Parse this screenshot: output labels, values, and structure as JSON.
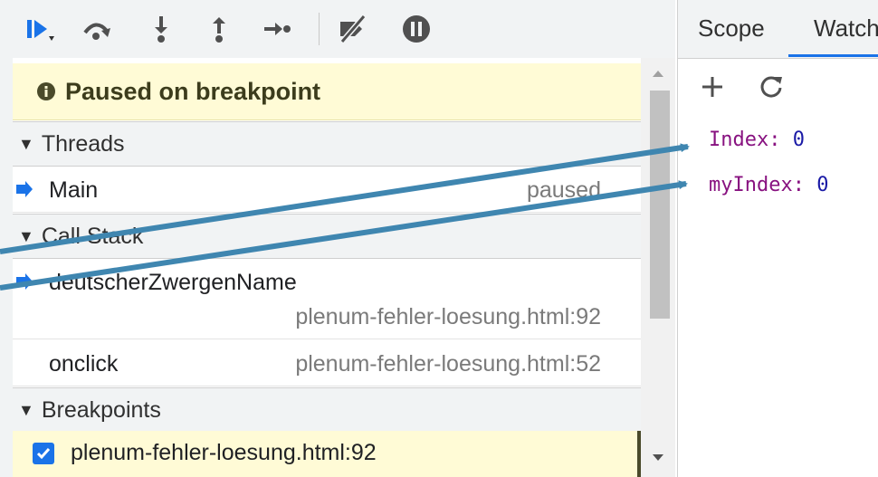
{
  "toolbar": {
    "icons": [
      "resume-icon",
      "step-over-icon",
      "step-into-icon",
      "step-out-icon",
      "step-icon",
      "deactivate-breakpoints-icon",
      "pause-on-exceptions-icon"
    ]
  },
  "status": {
    "paused_message": "Paused on breakpoint"
  },
  "threads": {
    "header": "Threads",
    "items": [
      {
        "name": "Main",
        "state": "paused"
      }
    ]
  },
  "call_stack": {
    "header": "Call Stack",
    "frames": [
      {
        "function": "deutscherZwergenName",
        "location": "plenum-fehler-loesung.html:92"
      },
      {
        "function": "onclick",
        "location": "plenum-fehler-loesung.html:52"
      }
    ]
  },
  "breakpoints": {
    "header": "Breakpoints",
    "items": [
      {
        "label": "plenum-fehler-loesung.html:92",
        "checked": true
      }
    ]
  },
  "right_panel": {
    "tabs": [
      "Scope",
      "Watch"
    ],
    "active_tab": "Watch",
    "watch_items": [
      {
        "name": "Index",
        "value": "0"
      },
      {
        "name": "myIndex",
        "value": "0"
      }
    ]
  },
  "colors": {
    "accent": "#1a73e8",
    "paused_bg": "#fffbd6",
    "annotation_arrow": "#3f86b0",
    "watch_name": "#881280",
    "watch_value": "#1a1aa6"
  }
}
